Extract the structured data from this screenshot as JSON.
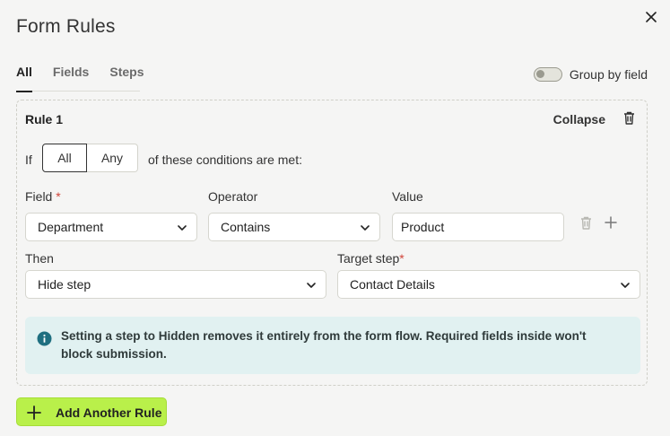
{
  "header": {
    "title": "Form Rules"
  },
  "tabs": [
    {
      "label": "All",
      "active": true
    },
    {
      "label": "Fields",
      "active": false
    },
    {
      "label": "Steps",
      "active": false
    }
  ],
  "group_toggle": {
    "label": "Group by field",
    "on": false
  },
  "rule": {
    "title": "Rule 1",
    "collapse_label": "Collapse",
    "if_label": "If",
    "match_options": [
      "All",
      "Any"
    ],
    "match_selected": "All",
    "conditions_text": "of these conditions are met:",
    "field_label": "Field",
    "operator_label": "Operator",
    "value_label": "Value",
    "field_value": "Department",
    "operator_value": "Contains",
    "value_value": "Product",
    "then_label": "Then",
    "target_label": "Target step",
    "then_value": "Hide step",
    "target_value": "Contact Details",
    "required_mark": "*",
    "info_text": "Setting a step to Hidden removes it entirely from the form flow. Required fields inside won't block submission."
  },
  "add_rule_label": "Add Another Rule",
  "colors": {
    "accent": "#b9f04a",
    "info_bg": "#e1f1f1",
    "required": "#d0443a",
    "info_icon": "#1f6f80"
  }
}
